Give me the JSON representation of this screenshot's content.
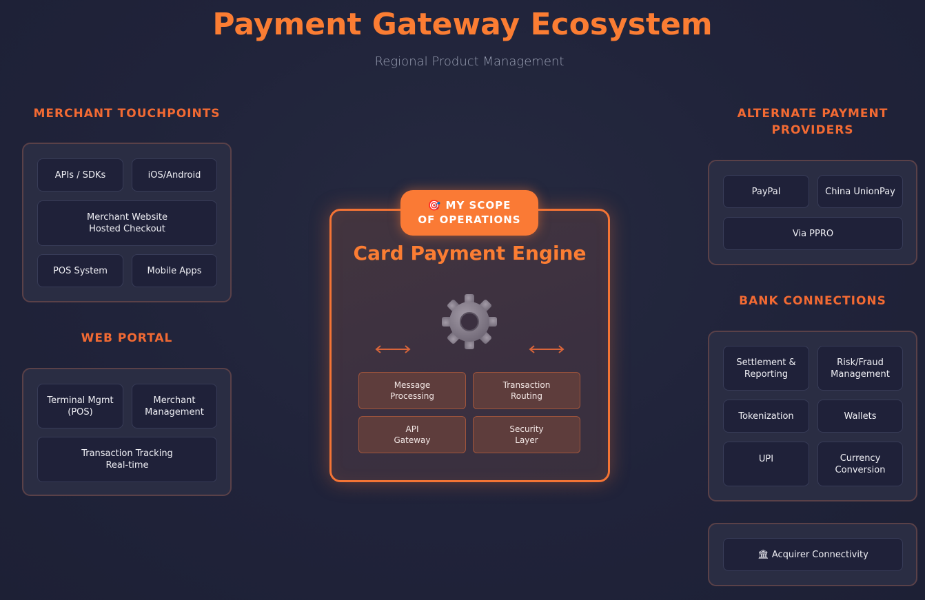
{
  "header": {
    "title": "Payment Gateway Ecosystem",
    "subtitle": "Regional Product Management"
  },
  "merchant_touchpoints": {
    "title": "MERCHANT TOUCHPOINTS",
    "items": [
      "APIs / SDKs",
      "iOS/Android",
      "Merchant Website\nHosted Checkout",
      "POS System",
      "Mobile Apps"
    ]
  },
  "web_portal": {
    "title": "WEB PORTAL",
    "items": [
      "Terminal Mgmt\n(POS)",
      "Merchant\nManagement",
      "Transaction Tracking\nReal-time"
    ]
  },
  "engine": {
    "badge_icon": "target-icon",
    "badge_line1": "🎯 MY SCOPE",
    "badge_line2": "OF OPERATIONS",
    "title": "Card Payment Engine",
    "center_icon": "gear-icon",
    "modules": [
      "Message\nProcessing",
      "Transaction\nRouting",
      "API\nGateway",
      "Security\nLayer"
    ]
  },
  "alternate_payment": {
    "title": "ALTERNATE PAYMENT\nPROVIDERS",
    "items": [
      "PayPal",
      "China UnionPay",
      "Via PPRO"
    ]
  },
  "bank_connections": {
    "title": "BANK CONNECTIONS",
    "items": [
      "Settlement &\nReporting",
      "Risk/Fraud\nManagement",
      "Tokenization",
      "Wallets",
      "UPI",
      "Currency\nConversion"
    ]
  },
  "acquirer": {
    "icon": "bank-icon",
    "label": "🏛 Acquirer Connectivity"
  },
  "colors": {
    "accent": "#fb7d33",
    "section_title": "#f26a33",
    "background": "#20233a"
  }
}
